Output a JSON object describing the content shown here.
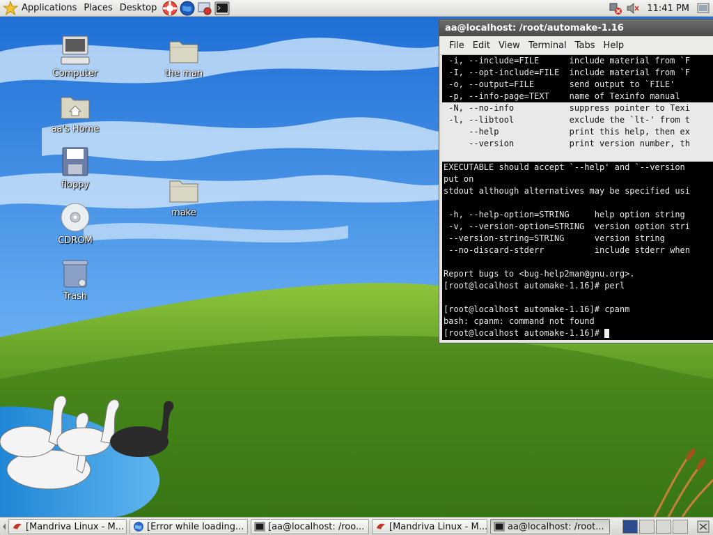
{
  "top_panel": {
    "menus": [
      "Applications",
      "Places",
      "Desktop"
    ],
    "launchers": [
      "help-icon",
      "browser-icon",
      "screenshot-icon",
      "terminal-icon"
    ],
    "clock": "11:41 PM"
  },
  "desktop_icons": [
    {
      "label": "Computer",
      "icon": "computer-icon"
    },
    {
      "label": "aa's Home",
      "icon": "home-folder-icon"
    },
    {
      "label": "floppy",
      "icon": "floppy-icon"
    },
    {
      "label": "CDROM",
      "icon": "cdrom-icon"
    },
    {
      "label": "Trash",
      "icon": "trash-icon"
    },
    {
      "label": "the man",
      "icon": "folder-icon"
    },
    {
      "label": "make",
      "icon": "folder-icon"
    }
  ],
  "terminal": {
    "title": "aa@localhost: /root/automake-1.16",
    "menu": [
      "File",
      "Edit",
      "View",
      "Terminal",
      "Tabs",
      "Help"
    ],
    "lines": [
      " -i, --include=FILE      include material from `F",
      " -I, --opt-include=FILE  include material from `F",
      " -o, --output=FILE       send output to `FILE'",
      " -p, --info-page=TEXT    name of Texinfo manual",
      " -N, --no-info           suppress pointer to Texi",
      " -l, --libtool           exclude the `lt-' from t",
      "     --help              print this help, then ex",
      "     --version           print version number, th",
      "",
      "EXECUTABLE should accept `--help' and `--version",
      "put on",
      "stdout although alternatives may be specified usi",
      "",
      " -h, --help-option=STRING     help option string",
      " -v, --version-option=STRING  version option stri",
      " --version-string=STRING      version string",
      " --no-discard-stderr          include stderr when",
      "",
      "Report bugs to <bug-help2man@gnu.org>.",
      "[root@localhost automake-1.16]# perl",
      "",
      "[root@localhost automake-1.16]# cpanm",
      "bash: cpanm: command not found",
      "[root@localhost automake-1.16]# "
    ]
  },
  "taskbar": {
    "tasks": [
      {
        "label": "[Mandriva Linux - M...",
        "icon": "mandriva-icon"
      },
      {
        "label": "[Error while loading...",
        "icon": "browser-icon"
      },
      {
        "label": "[aa@localhost: /roo...",
        "icon": "terminal-icon"
      },
      {
        "label": "[Mandriva Linux - M...",
        "icon": "mandriva-icon"
      },
      {
        "label": "aa@localhost: /root...",
        "icon": "terminal-icon"
      }
    ],
    "workspaces": 4
  }
}
